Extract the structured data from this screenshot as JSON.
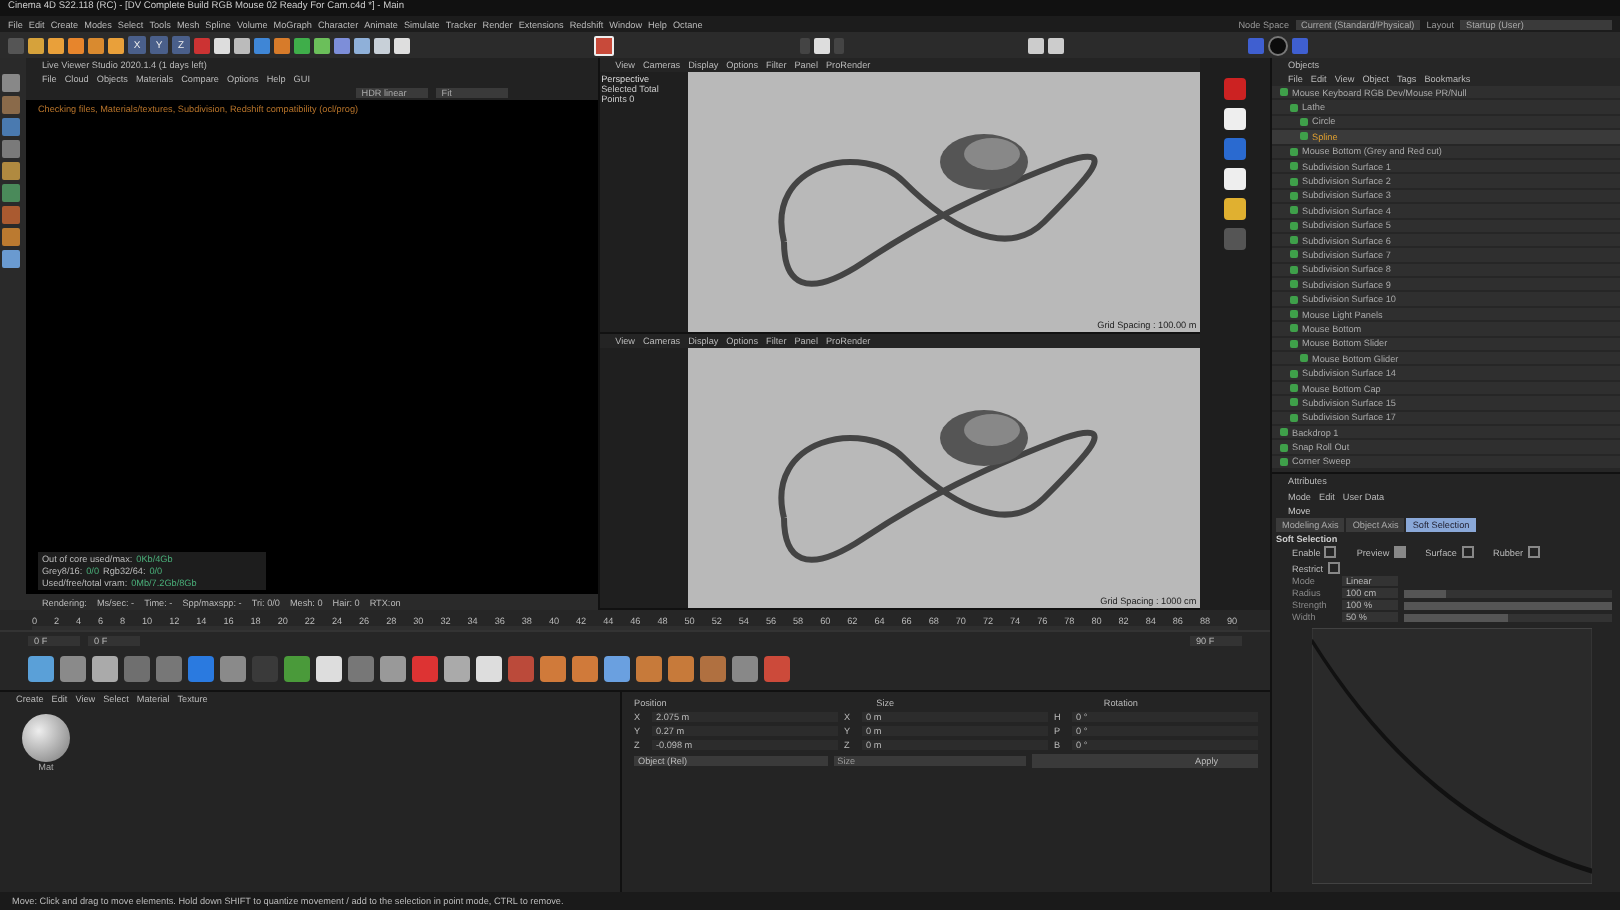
{
  "window": {
    "title": "Cinema 4D S22.118 (RC) - [DV Complete Build RGB Mouse 02 Ready For Cam.c4d *] - Main"
  },
  "menu": [
    "File",
    "Edit",
    "Create",
    "Modes",
    "Select",
    "Tools",
    "Mesh",
    "Spline",
    "Volume",
    "MoGraph",
    "Character",
    "Animate",
    "Simulate",
    "Tracker",
    "Render",
    "Extensions",
    "Redshift",
    "Window",
    "Help",
    "Octane"
  ],
  "toolbar": {
    "axis_buttons": [
      "X",
      "Y",
      "Z"
    ]
  },
  "node_space": {
    "label": "Node Space",
    "value": "Current (Standard/Physical)"
  },
  "layout": {
    "label": "Layout",
    "value": "Startup (User)"
  },
  "live_viewer": {
    "title": "Live Viewer Studio 2020.1.4 (1 days left)",
    "menu": [
      "File",
      "Cloud",
      "Objects",
      "Materials",
      "Compare",
      "Options",
      "Help",
      "GUI"
    ],
    "mode": "HDR linear",
    "zoom": "Fit",
    "message": "Checking files, Materials/textures, Subdivision, Redshift compatibility (ocl/prog)",
    "stats": [
      {
        "label": "Out of core used/max:",
        "value": "0Kb/4Gb"
      },
      {
        "label": "Grey8/16:",
        "value": "0/0",
        "label2": "Rgb32/64:",
        "value2": "0/0"
      },
      {
        "label": "Used/free/total vram:",
        "value": "0Mb/7.2Gb/8Gb"
      }
    ],
    "status": [
      "Rendering:",
      "Ms/sec: -",
      "Time: -",
      "Spp/maxspp: -",
      "Tri: 0/0",
      "Mesh: 0",
      "Hair: 0",
      "RTX:on"
    ]
  },
  "viewports": [
    {
      "menu": [
        "View",
        "Cameras",
        "Display",
        "Options",
        "Filter",
        "Panel",
        "ProRender"
      ],
      "camera": "Perspective",
      "hud": [
        "Selected Total",
        "Points 0"
      ],
      "grid": "Grid Spacing : 100.00 m"
    },
    {
      "menu": [
        "View",
        "Cameras",
        "Display",
        "Options",
        "Filter",
        "Panel",
        "ProRender"
      ],
      "grid": "Grid Spacing : 1000 cm"
    }
  ],
  "objects": {
    "title": "Objects",
    "menu": [
      "File",
      "Edit",
      "View",
      "Object",
      "Tags",
      "Bookmarks"
    ],
    "items": [
      {
        "name": "Mouse Keyboard RGB Dev/Mouse PR/Null",
        "selected": false,
        "children": [
          {
            "name": "Lathe",
            "selected": false,
            "children": [
              {
                "name": "Circle",
                "selected": false
              },
              {
                "name": "Spline",
                "selected": true
              }
            ]
          },
          {
            "name": "Mouse Bottom (Grey and Red cut)",
            "selected": false
          },
          {
            "name": "Subdivision Surface 1",
            "selected": false
          },
          {
            "name": "Subdivision Surface 2",
            "selected": false
          },
          {
            "name": "Subdivision Surface 3",
            "selected": false
          },
          {
            "name": "Subdivision Surface 4",
            "selected": false
          },
          {
            "name": "Subdivision Surface 5",
            "selected": false
          },
          {
            "name": "Subdivision Surface 6",
            "selected": false
          },
          {
            "name": "Subdivision Surface 7",
            "selected": false
          },
          {
            "name": "Subdivision Surface 8",
            "selected": false
          },
          {
            "name": "Subdivision Surface 9",
            "selected": false
          },
          {
            "name": "Subdivision Surface 10",
            "selected": false
          },
          {
            "name": "Mouse Light Panels",
            "selected": false
          },
          {
            "name": "Mouse Bottom",
            "selected": false
          },
          {
            "name": "Mouse Bottom Slider",
            "selected": false,
            "children": [
              {
                "name": "Mouse Bottom Glider",
                "selected": false
              }
            ]
          },
          {
            "name": "Subdivision Surface 14",
            "selected": false
          },
          {
            "name": "Mouse Bottom Cap",
            "selected": false
          },
          {
            "name": "Subdivision Surface 15",
            "selected": false
          },
          {
            "name": "Subdivision Surface 17",
            "selected": false
          }
        ]
      },
      {
        "name": "Backdrop 1",
        "selected": false
      },
      {
        "name": "Snap Roll Out",
        "selected": false
      },
      {
        "name": "Corner Sweep",
        "selected": false
      }
    ]
  },
  "attributes": {
    "title": "Attributes",
    "menu": [
      "Mode",
      "Edit",
      "User Data"
    ],
    "tool": "Move",
    "tabs": [
      {
        "label": "Modeling Axis",
        "selected": false
      },
      {
        "label": "Object Axis",
        "selected": false
      },
      {
        "label": "Soft Selection",
        "selected": true
      }
    ],
    "section": "Soft Selection",
    "checks": [
      {
        "label": "Enable",
        "checked": false
      },
      {
        "label": "Preview",
        "checked": true
      },
      {
        "label": "Surface",
        "checked": false
      },
      {
        "label": "Rubber",
        "checked": false
      },
      {
        "label": "Restrict",
        "checked": false
      }
    ],
    "fields": [
      {
        "label": "Mode",
        "value": "Linear"
      },
      {
        "label": "Radius",
        "value": "100 cm",
        "level": 0.2
      },
      {
        "label": "Strength",
        "value": "100 %",
        "level": 1
      },
      {
        "label": "Width",
        "value": "50 %",
        "level": 0.5
      }
    ]
  },
  "timeline": {
    "ticks": [
      "0",
      "2",
      "4",
      "6",
      "8",
      "10",
      "12",
      "14",
      "16",
      "18",
      "20",
      "22",
      "24",
      "26",
      "28",
      "30",
      "32",
      "34",
      "36",
      "38",
      "40",
      "42",
      "44",
      "46",
      "48",
      "50",
      "52",
      "54",
      "56",
      "58",
      "60",
      "62",
      "64",
      "66",
      "68",
      "70",
      "72",
      "74",
      "76",
      "78",
      "80",
      "82",
      "84",
      "86",
      "88",
      "90"
    ],
    "start": "0 F",
    "current": "0 F",
    "end": "90 F",
    "level": 0
  },
  "materials": {
    "menu": [
      "Create",
      "Edit",
      "View",
      "Select",
      "Material",
      "Texture"
    ],
    "items": [
      {
        "name": "Mat"
      }
    ]
  },
  "coordinates": {
    "headers": [
      "Position",
      "Size",
      "Rotation"
    ],
    "rows": [
      {
        "axis": "X",
        "pos": "2.075 m",
        "size_axis": "X",
        "size": "0 m",
        "rot_axis": "H",
        "rot": "0 °"
      },
      {
        "axis": "Y",
        "pos": "0.27 m",
        "size_axis": "Y",
        "size": "0 m",
        "rot_axis": "P",
        "rot": "0 °"
      },
      {
        "axis": "Z",
        "pos": "-0.098 m",
        "size_axis": "Z",
        "size": "0 m",
        "rot_axis": "B",
        "rot": "0 °"
      }
    ],
    "mode": "Object (Rel)",
    "size_mode": "Size",
    "apply": "Apply"
  },
  "status_bar": "Move: Click and drag to move elements. Hold down SHIFT to quantize movement / add to the selection in point mode, CTRL to remove."
}
